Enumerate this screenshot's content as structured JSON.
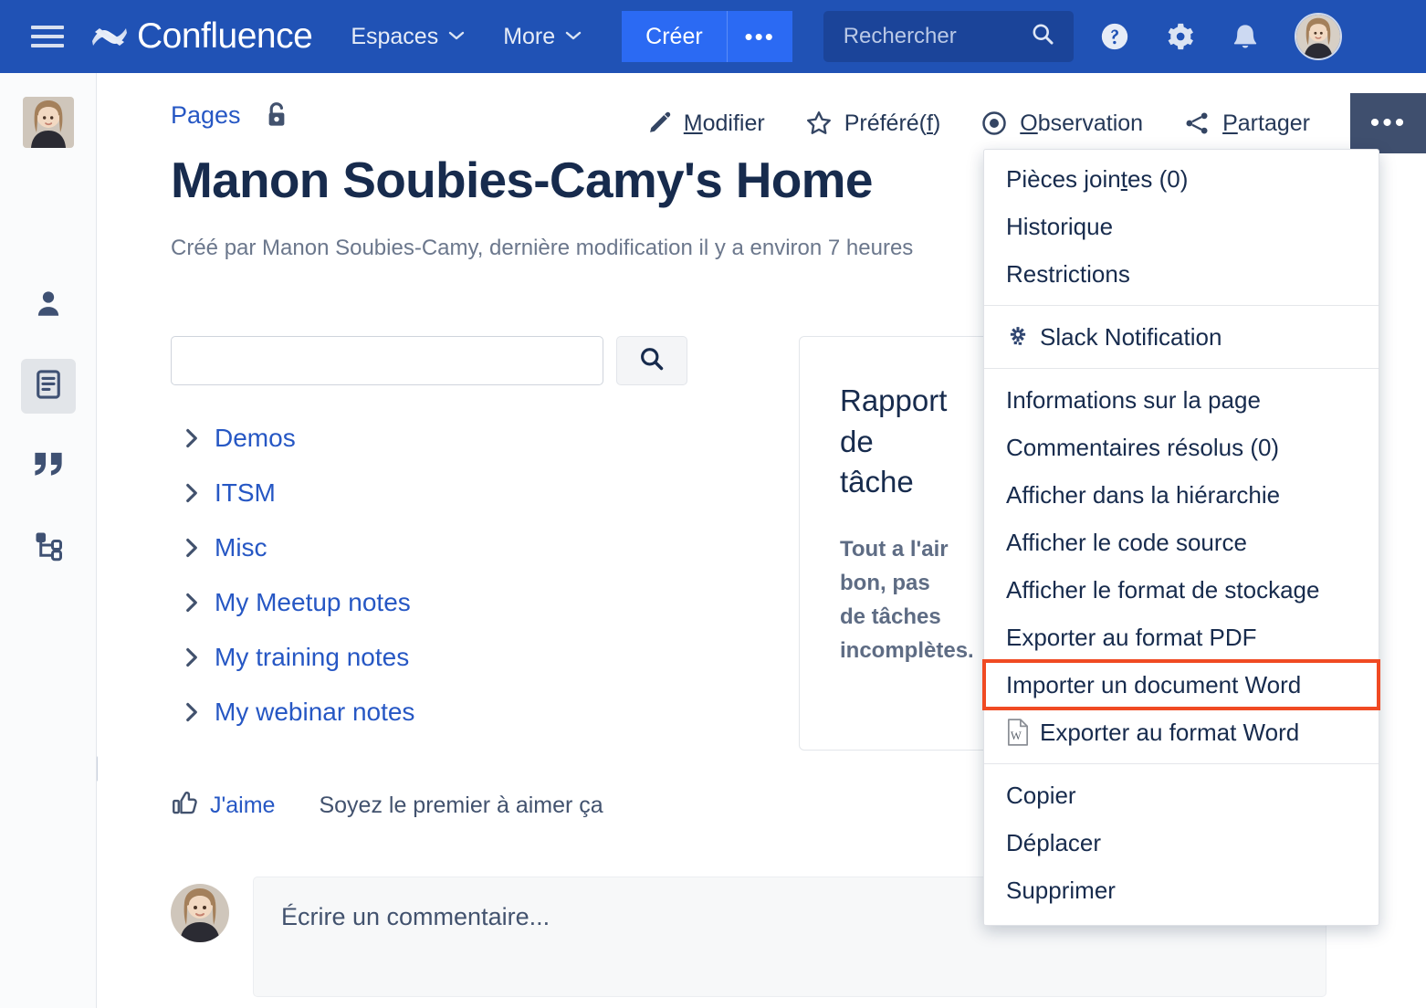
{
  "topnav": {
    "menu_icon": "hamburger-icon",
    "brand": "Confluence",
    "links": [
      {
        "label": "Espaces",
        "caret": "⌄"
      },
      {
        "label": "More",
        "caret": "⌄"
      }
    ],
    "create_label": "Créer",
    "create_more_label": "•••",
    "search_placeholder": "Rechercher",
    "icons": [
      "help-icon",
      "settings-gear-icon",
      "notifications-bell-icon"
    ],
    "avatar_alt": "user-avatar"
  },
  "leftrail": {
    "items": [
      {
        "name": "space-avatar",
        "icon": "space-avatar-image"
      },
      {
        "name": "people-icon",
        "icon": "person-icon"
      },
      {
        "name": "pages-icon",
        "icon": "page-document-icon",
        "active": true
      },
      {
        "name": "blog-icon",
        "icon": "quotation-marks-icon"
      },
      {
        "name": "page-tree-icon",
        "icon": "hierarchy-tree-icon"
      }
    ]
  },
  "breadcrumb": {
    "label": "Pages",
    "lock_icon": "unlocked-padlock-icon"
  },
  "page": {
    "title": "Manon Soubies-Camy's Home",
    "subtitle": "Créé par Manon Soubies-Camy, dernière modification il y a environ 7 heures"
  },
  "pagetools": [
    {
      "label_pre": "",
      "accesskey": "M",
      "label_post": "odifier",
      "icon": "pencil-icon",
      "name": "edit-button"
    },
    {
      "label_pre": "Préféré(",
      "accesskey": "f",
      "label_post": ")",
      "icon": "star-icon",
      "name": "favorite-button"
    },
    {
      "label_pre": "",
      "accesskey": "O",
      "label_post": "bservation",
      "icon": "watch-eye-icon",
      "name": "watch-button"
    },
    {
      "label_pre": "",
      "accesskey": "P",
      "label_post": "artager",
      "icon": "share-icon",
      "name": "share-button"
    }
  ],
  "more_button_label": "•••",
  "tree": {
    "search_value": "",
    "search_placeholder": "",
    "search_button_icon": "search-icon",
    "items": [
      {
        "label": "Demos"
      },
      {
        "label": "ITSM"
      },
      {
        "label": "Misc"
      },
      {
        "label": "My Meetup notes"
      },
      {
        "label": "My training notes"
      },
      {
        "label": "My webinar notes"
      }
    ]
  },
  "task_report": {
    "title": "Rapport de tâche",
    "message": "Tout a l'air bon, pas de tâches incomplètes."
  },
  "like": {
    "button_label": "J'aime",
    "icon": "thumbs-up-icon",
    "note": "Soyez le premier à aimer ça"
  },
  "comment": {
    "placeholder": "Écrire un commentaire...",
    "avatar_alt": "commenter-avatar"
  },
  "more_menu": {
    "groups": [
      {
        "items": [
          {
            "label_pre": "Pièces join",
            "accesskey": "t",
            "label_post": "es (0)",
            "name": "menu-item-attachments"
          },
          {
            "label_pre": "Historique",
            "accesskey": "",
            "label_post": "",
            "name": "menu-item-history"
          },
          {
            "label_pre": "Restrictions",
            "accesskey": "",
            "label_post": "",
            "name": "menu-item-restrictions"
          }
        ]
      },
      {
        "items": [
          {
            "label_pre": "Slack Notification",
            "accesskey": "",
            "label_post": "",
            "icon": "slack-gear-icon",
            "name": "menu-item-slack-notification"
          }
        ]
      },
      {
        "items": [
          {
            "label_pre": "Informations sur la page",
            "accesskey": "",
            "label_post": "",
            "name": "menu-item-page-information"
          },
          {
            "label_pre": "Commentaires résolus (0)",
            "accesskey": "",
            "label_post": "",
            "name": "menu-item-resolved-comments"
          },
          {
            "label_pre": "Afficher dans la hiérarchie",
            "accesskey": "",
            "label_post": "",
            "name": "menu-item-view-in-hierarchy"
          },
          {
            "label_pre": "Afficher le code source",
            "accesskey": "",
            "label_post": "",
            "name": "menu-item-view-source"
          },
          {
            "label_pre": "Afficher le format de stockage",
            "accesskey": "",
            "label_post": "",
            "name": "menu-item-view-storage-format"
          },
          {
            "label_pre": "Exporter au format PDF",
            "accesskey": "",
            "label_post": "",
            "name": "menu-item-export-pdf"
          },
          {
            "label_pre": "Importer un document Word",
            "accesskey": "",
            "label_post": "",
            "name": "menu-item-import-word",
            "highlighted": true
          },
          {
            "label_pre": "Exporter au format Word",
            "accesskey": "",
            "label_post": "",
            "icon": "word-document-icon",
            "name": "menu-item-export-word"
          }
        ]
      },
      {
        "items": [
          {
            "label_pre": "Copier",
            "accesskey": "",
            "label_post": "",
            "name": "menu-item-copy"
          },
          {
            "label_pre": "Déplacer",
            "accesskey": "",
            "label_post": "",
            "name": "menu-item-move"
          },
          {
            "label_pre": "Supprimer",
            "accesskey": "",
            "label_post": "",
            "name": "menu-item-delete"
          }
        ]
      }
    ]
  },
  "colors": {
    "nav_blue": "#2052b5",
    "create_blue": "#2b6af3",
    "search_field_blue": "#1b4499",
    "link_blue": "#2657c4",
    "text_navy": "#172b4d",
    "muted": "#6b778c",
    "highlight_orange": "#f04a23",
    "dots_button": "#3f4f6e"
  }
}
